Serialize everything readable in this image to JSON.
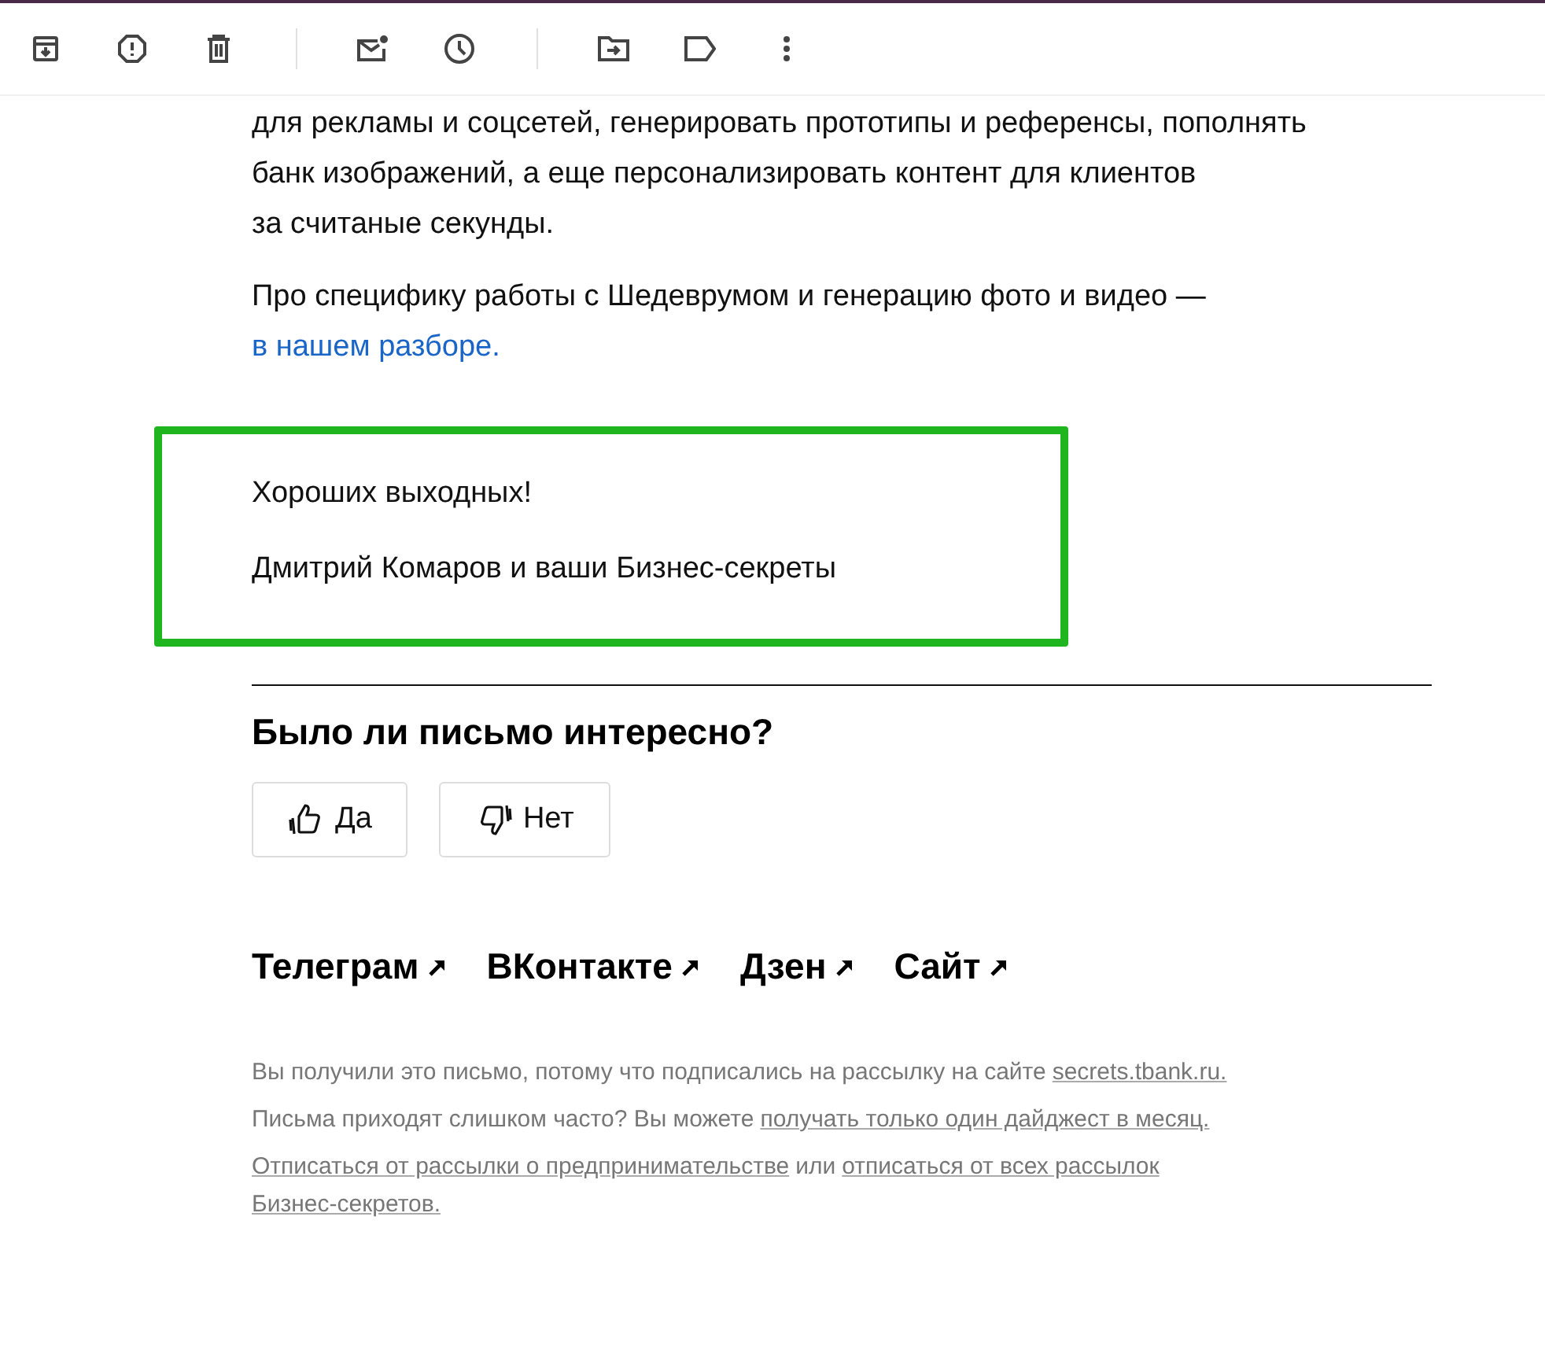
{
  "toolbar": {
    "groups": [
      [
        {
          "kind": "archive"
        },
        {
          "kind": "report"
        },
        {
          "kind": "delete"
        }
      ],
      [
        {
          "kind": "unread"
        },
        {
          "kind": "snooze"
        }
      ],
      [
        {
          "kind": "move"
        },
        {
          "kind": "label"
        },
        {
          "kind": "more"
        }
      ]
    ]
  },
  "body": [
    {
      "lines": [
        "для рекламы и соцсетей, генерировать прототипы и референсы, пополнять",
        "банк изображений, а еще персонализировать контент для клиентов",
        "за считаные секунды."
      ]
    },
    {
      "lines": [
        "Про специфику работы с Шедеврумом и генерацию фото и видео —"
      ],
      "link": "в нашем разборе."
    }
  ],
  "signature": [
    "Хороших выходных!",
    "Дмитрий Комаров и ваши Бизнес-секреты"
  ],
  "feedback": {
    "title": "Было ли письмо интересно?",
    "buttons": [
      {
        "kind": "up",
        "label": "Да"
      },
      {
        "kind": "down",
        "label": "Нет"
      }
    ]
  },
  "social": [
    "Телеграм",
    "ВКонтакте",
    "Дзен",
    "Сайт"
  ],
  "footer": [
    {
      "lines": [
        [
          {
            "text": "Вы получили это письмо, потому что подписались на рассылку на сайте",
            "link": false
          },
          {
            "text": "secrets.tbank.ru.",
            "link": true
          }
        ]
      ]
    },
    {
      "lines": [
        [
          {
            "text": "Письма приходят слишком часто? Вы можете",
            "link": false
          },
          {
            "text": "получать только один дайджест в месяц.",
            "link": true
          }
        ]
      ]
    },
    {
      "lines": [
        [
          {
            "text": "Отписаться от рассылки о предпринимательстве",
            "link": true
          },
          {
            "text": "или",
            "link": false
          },
          {
            "text": "отписаться от всех рассылок",
            "link": true
          }
        ],
        [
          {
            "text": "Бизнес-секретов.",
            "link": true
          }
        ]
      ]
    }
  ]
}
